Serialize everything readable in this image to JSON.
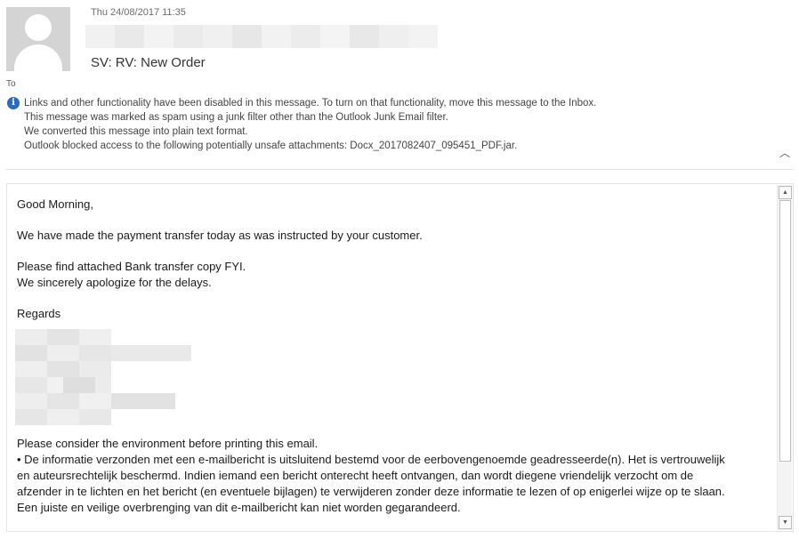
{
  "header": {
    "date": "Thu 24/08/2017 11:35",
    "subject": "SV: RV: New Order",
    "to_label": "To"
  },
  "infobar": {
    "icon": "info-icon",
    "lines": [
      "Links and other functionality have been disabled in this message. To turn on that functionality, move this message to the Inbox.",
      "This message was marked as spam using a junk filter other than the Outlook Junk Email filter.",
      "We converted this message into plain text format.",
      "Outlook blocked access to the following potentially unsafe attachments: Docx_2017082407_095451_PDF.jar."
    ]
  },
  "message": {
    "greeting": "Good Morning,",
    "line1": "We have made the payment transfer today as was instructed by your customer.",
    "line2": "Please find attached Bank transfer copy FYI.",
    "line3": "We sincerely apologize for the delays.",
    "regards": "Regards",
    "footer1": "Please consider the environment before printing this email.",
    "footer2": "• De informatie verzonden met een e-mailbericht is uitsluitend bestemd voor de eerbovengenoemde geadresseerde(n). Het is vertrouwelijk",
    "footer3": "en auteursrechtelijk beschermd. Indien iemand een bericht onterecht heeft ontvangen, dan wordt diegene vriendelijk verzocht om de",
    "footer4": "afzender in te lichten en het bericht (en eventuele bijlagen) te verwijderen zonder deze informatie te lezen of op enigerlei wijze op te slaan.",
    "footer5": "Een juiste en veilige overbrenging van dit e-mailbericht kan niet worden gegarandeerd."
  },
  "controls": {
    "collapse_glyph": "︿",
    "scroll_up_glyph": "▲",
    "scroll_down_glyph": "▼"
  }
}
